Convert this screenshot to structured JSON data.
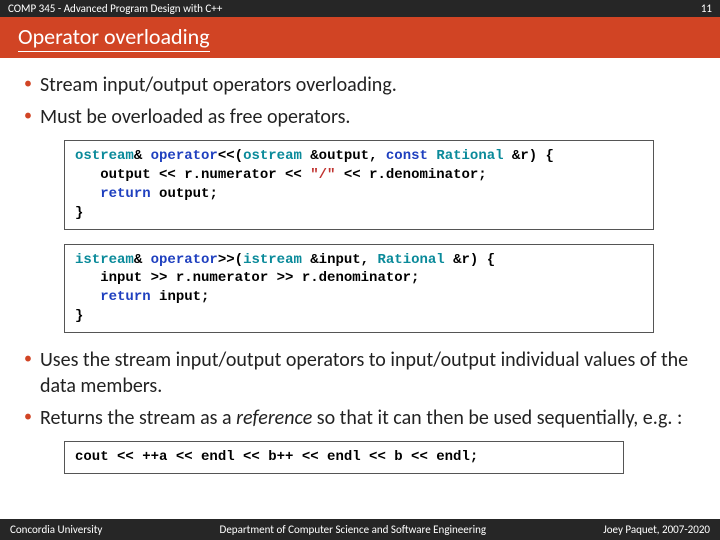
{
  "meta": {
    "course": "COMP 345 - Advanced Program Design with C++",
    "pageNum": "11"
  },
  "title": "Operator overloading",
  "bullets": {
    "b1": "Stream input/output operators overloading.",
    "b2": "Must be overloaded as free operators.",
    "b3": "Uses the stream input/output operators to input/output individual values of the data members.",
    "b4a": "Returns the stream as a ",
    "b4i": "reference",
    "b4b": " so that it can then be used sequentially, e.g. :"
  },
  "code1": {
    "t1": "ostream",
    "t2": "& ",
    "t3": "operator",
    "t4": "<<(",
    "t5": "ostream",
    "t6": " &output, ",
    "t7": "const",
    "t8": " ",
    "t9": "Rational",
    "t10": " &r) {",
    "l2a": "   output << r.numerator << ",
    "l2b": "\"/\"",
    "l2c": " << r.denominator;",
    "l3a": "   ",
    "l3b": "return",
    "l3c": " output;",
    "l4": "}"
  },
  "code2": {
    "t1": "istream",
    "t2": "& ",
    "t3": "operator",
    "t4": ">>(",
    "t5": "istream",
    "t6": " &input, ",
    "t7": "Rational",
    "t8": " &r) {",
    "l2": "   input >> r.numerator >> r.denominator;",
    "l3a": "   ",
    "l3b": "return",
    "l3c": " input;",
    "l4": "}"
  },
  "code3": {
    "line": "cout << ++a << endl << b++ << endl << b << endl;"
  },
  "footer": {
    "left": "Concordia University",
    "center": "Department of Computer Science and Software Engineering",
    "right": "Joey Paquet, 2007-2020"
  }
}
